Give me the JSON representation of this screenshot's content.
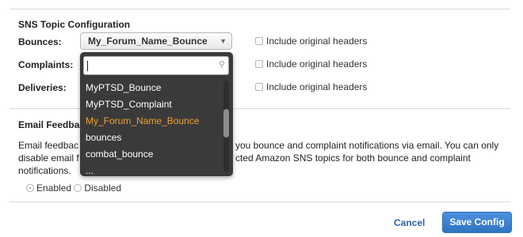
{
  "sns_section": {
    "title": "SNS Topic Configuration",
    "rows": [
      {
        "label": "Bounces:",
        "checkbox_label": "Include original headers",
        "checked": false
      },
      {
        "label": "Complaints:",
        "checkbox_label": "Include original headers",
        "checked": false
      },
      {
        "label": "Deliveries:",
        "checkbox_label": "Include original headers",
        "checked": false
      }
    ],
    "bounces_select": {
      "value": "My_Forum_Name_Bounce",
      "icon": "chevron-down-icon"
    }
  },
  "dropdown": {
    "search_value": "",
    "search_icon": "search-icon",
    "items": [
      {
        "label": "MyPTSD_Bounce",
        "selected": false
      },
      {
        "label": "MyPTSD_Complaint",
        "selected": false
      },
      {
        "label": "My_Forum_Name_Bounce",
        "selected": true
      },
      {
        "label": "bounces",
        "selected": false
      },
      {
        "label": "combat_bounce",
        "selected": false
      }
    ],
    "partial_item": "...",
    "selected_color": "#f0a030",
    "background_color": "#3a3a3a"
  },
  "email_section": {
    "title_visible": "Email Feedbac",
    "description_lines": [
      "Email feedbac",
      "disable email f",
      "notifications."
    ],
    "description_right": [
      "you bounce and complaint notifications via email. You can only",
      "cted Amazon SNS topics for both bounce and complaint"
    ],
    "forwarding_options": [
      {
        "label": "Enabled",
        "checked": true
      },
      {
        "label": "Disabled",
        "checked": false
      }
    ]
  },
  "footer": {
    "cancel_label": "Cancel",
    "save_label": "Save Config",
    "primary_color": "#2f74c4"
  }
}
